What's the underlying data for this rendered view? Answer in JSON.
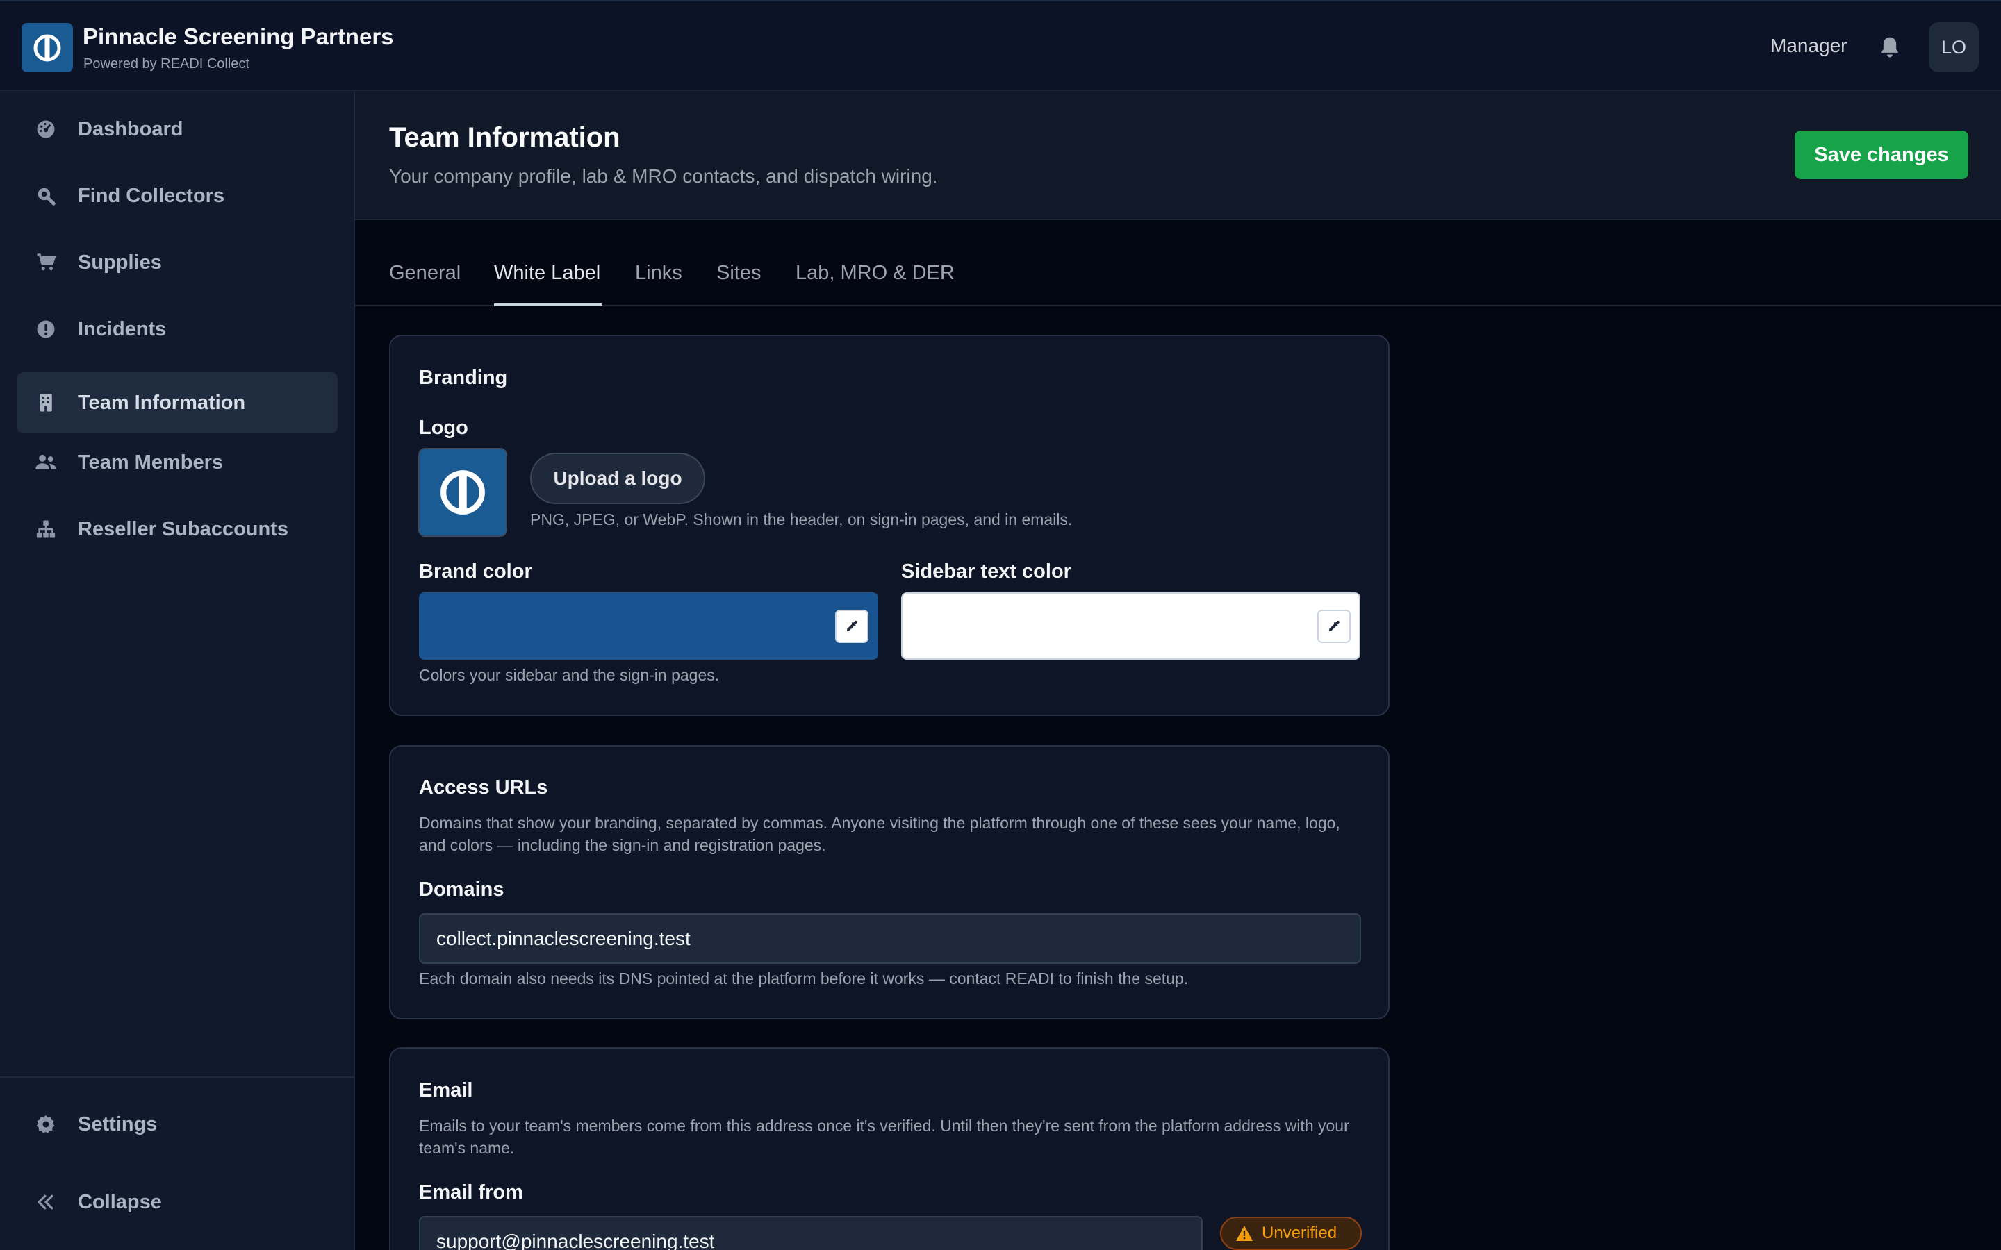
{
  "header": {
    "org_name": "Pinnacle Screening Partners",
    "powered_by": "Powered by READI Collect",
    "role": "Manager",
    "avatar_initials": "LO",
    "bell_icon": "bell-icon",
    "brand_color": "#1b5b94"
  },
  "sidebar": {
    "items": [
      {
        "label": "Dashboard",
        "icon": "gauge-icon"
      },
      {
        "label": "Find Collectors",
        "icon": "search-icon"
      },
      {
        "label": "Supplies",
        "icon": "cart-icon"
      },
      {
        "label": "Incidents",
        "icon": "alert-circle-icon"
      },
      {
        "label": "Team Information",
        "icon": "building-icon",
        "active": true
      },
      {
        "label": "Team Members",
        "icon": "users-icon"
      },
      {
        "label": "Reseller Subaccounts",
        "icon": "hierarchy-icon"
      }
    ],
    "footer": [
      {
        "label": "Settings",
        "icon": "gear-icon"
      },
      {
        "label": "Collapse",
        "icon": "chevrons-left-icon"
      }
    ]
  },
  "page": {
    "title": "Team Information",
    "subtitle": "Your company profile, lab & MRO contacts, and dispatch wiring.",
    "save_label": "Save changes",
    "save_color": "#16a34a"
  },
  "tabs": [
    {
      "label": "General"
    },
    {
      "label": "White Label",
      "active": true
    },
    {
      "label": "Links"
    },
    {
      "label": "Sites"
    },
    {
      "label": "Lab, MRO & DER"
    }
  ],
  "branding": {
    "title": "Branding",
    "logo_label": "Logo",
    "upload_label": "Upload a logo",
    "logo_help": "PNG, JPEG, or WebP. Shown in the header, on sign-in pages, and in emails.",
    "brand_color_label": "Brand color",
    "brand_color_value": "#1a5490",
    "sidebar_text_color_label": "Sidebar text color",
    "sidebar_text_color_value": "#ffffff",
    "colors_help": "Colors your sidebar and the sign-in pages."
  },
  "access_urls": {
    "title": "Access URLs",
    "description": "Domains that show your branding, separated by commas. Anyone visiting the platform through one of these sees your name, logo, and colors — including the sign-in and registration pages.",
    "domains_label": "Domains",
    "domains_value": "collect.pinnaclescreening.test",
    "domains_help": "Each domain also needs its DNS pointed at the platform before it works — contact READI to finish the setup."
  },
  "email": {
    "title": "Email",
    "description": "Emails to your team's members come from this address once it's verified. Until then they're sent from the platform address with your team's name.",
    "from_label": "Email from",
    "from_value": "support@pinnaclescreening.test",
    "status": "Unverified",
    "status_color": "#f59e0b"
  }
}
